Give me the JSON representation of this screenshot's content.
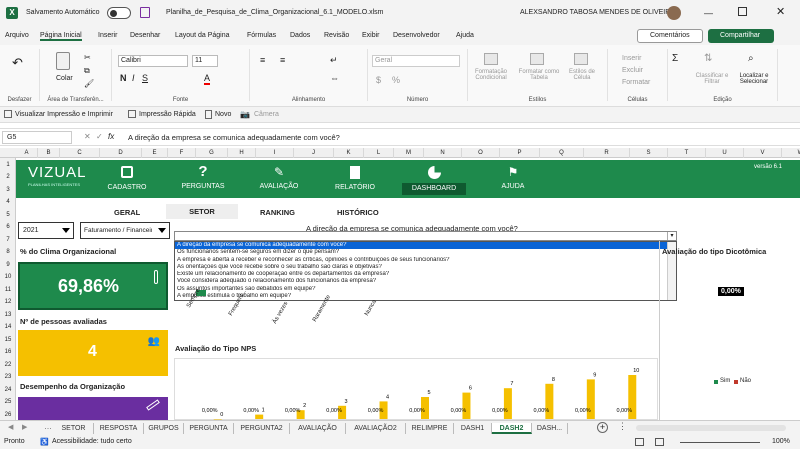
{
  "titlebar": {
    "autosave_label": "Salvamento Automático",
    "file_name": "Planilha_de_Pesquisa_de_Clima_Organizacional_6.1_MODELO.xlsm",
    "user_name": "ALEXSANDRO TABOSA MENDES DE OLIVEIRA"
  },
  "menu": {
    "items": [
      "Arquivo",
      "Página Inicial",
      "Inserir",
      "Desenhar",
      "Layout da Página",
      "Fórmulas",
      "Dados",
      "Revisão",
      "Exibir",
      "Desenvolvedor",
      "Ajuda"
    ],
    "comments_label": "Comentários",
    "share_label": "Compartilhar"
  },
  "ribbon": {
    "paste_label": "Colar",
    "font_name": "Calibri",
    "font_size": "11",
    "number_format": "Geral",
    "cond_format": "Formatação Condicional",
    "format_table": "Formatar como Tabela",
    "cell_styles": "Estilos de Célula",
    "insert": "Inserir",
    "delete": "Excluir",
    "format": "Formatar",
    "sort_filter": "Classificar e Filtrar",
    "find_select": "Localizar e Selecionar",
    "groups": [
      "Desfazer",
      "Área de Transferên...",
      "Fonte",
      "Alinhamento",
      "Número",
      "Estilos",
      "Células",
      "Edição"
    ]
  },
  "quickaccess": {
    "print_preview": "Visualizar Impressão e Imprimir",
    "quick_print": "Impressão Rápida",
    "new": "Novo",
    "camera": "Câmera"
  },
  "formula_bar": {
    "name_box": "G5",
    "fx": "fx",
    "formula": "A direção da empresa se comunica adequadamente com você?"
  },
  "columns": [
    "A",
    "B",
    "C",
    "D",
    "E",
    "F",
    "G",
    "H",
    "I",
    "J",
    "K",
    "L",
    "M",
    "N",
    "O",
    "P",
    "Q",
    "R",
    "S",
    "T",
    "U",
    "V",
    "W"
  ],
  "rows": [
    "1",
    "2",
    "3",
    "4",
    "5",
    "6",
    "7",
    "8",
    "9",
    "10",
    "11",
    "12",
    "13",
    "14",
    "15",
    "16",
    "22",
    "23",
    "24",
    "25",
    "26"
  ],
  "dashboard": {
    "logo": "VIZUAL",
    "logo_sub": "PLANILHAS INTELIGENTES",
    "version": "versão 6.1",
    "nav": [
      "CADASTRO",
      "PERGUNTAS",
      "AVALIAÇÃO",
      "RELATÓRIO",
      "DASHBOARD",
      "AJUDA"
    ],
    "subtabs": [
      "GERAL",
      "SETOR",
      "RANKING",
      "HISTÓRICO"
    ],
    "year": "2021",
    "setor": "Faturamento / Financeiro",
    "question_title": "A direção da empresa se comunica adequadamente com você?",
    "question_combo": "A direção da empresa se comunica adequadamente com você?",
    "options": [
      "A direção da empresa se comunica adequadamente com você?",
      "Os funcionários sentem-se seguros em dizer o que pensam?",
      "A empresa é aberta a receber e reconhecer as críticas, opiniões e contribuições de seus funcionários?",
      "As orientações que você recebe sobre o seu trabalho são claras e objetivas?",
      "Existe um relacionamento de cooperação entre os departamentos da empresa?",
      "Você considera adequado o relacionamento dos funcionários da empresa?",
      "Os assuntos importantes são debatidos em equipe?",
      "A empresa estimula o trabalho em equipe?"
    ],
    "clima_label": "% do Clima Organizacional",
    "clima_value": "69,86%",
    "pessoas_label": "Nº de pessoas avaliadas",
    "pessoas_value": "4",
    "desempenho_label": "Desempenho da Organização",
    "dicotomica_title": "Avaliação do tipo Dicotômica",
    "dicotomica_value": "0,00%",
    "legend_sim": "Sim",
    "legend_nao": "Não",
    "nps_title": "Avaliação do Tipo NPS",
    "scale_axis": [
      "Sempre",
      "Frequent...",
      "Às vezes",
      "Raramente",
      "Nunca"
    ]
  },
  "chart_data": {
    "type": "bar",
    "title": "Avaliação do Tipo NPS",
    "categories": [
      "0",
      "1",
      "2",
      "3",
      "4",
      "5",
      "6",
      "7",
      "8",
      "9",
      "10"
    ],
    "series": [
      {
        "values": [
          0,
          1,
          2,
          3,
          4,
          5,
          6,
          7,
          8,
          9,
          10
        ]
      }
    ],
    "data_labels": [
      "0,00%",
      "0,00%",
      "0,00%",
      "0,00%",
      "0,00%",
      "0,00%",
      "0,00%",
      "0,00%",
      "0,00%",
      "0,00%",
      "0,00%"
    ],
    "ylim": [
      0,
      10
    ],
    "bar_color": "#f5c000"
  },
  "sheet_tabs": [
    "SETOR",
    "RESPOSTA",
    "GRUPOS",
    "PERGUNTA",
    "PERGUNTA2",
    "AVALIAÇÃO",
    "AVALIAÇÃO2",
    "RELIMPRE",
    "DASH1",
    "DASH2",
    "DASH..."
  ],
  "status": {
    "ready": "Pronto",
    "accessibility": "Acessibilidade: tudo certo",
    "zoom": "100%"
  },
  "colors": {
    "green": "#1e8a4c",
    "nav_active": "#0f5a30",
    "yellow": "#f5c000",
    "purple": "#6a2ea0",
    "excel_green": "#1d6f42"
  }
}
